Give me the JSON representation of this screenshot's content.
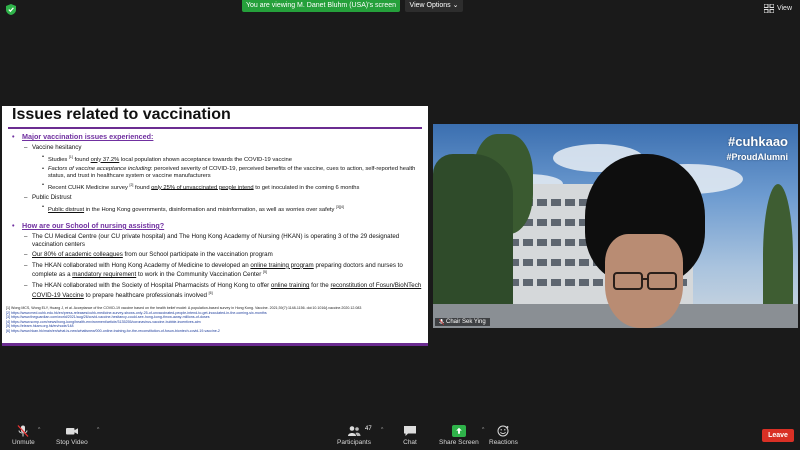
{
  "topbar": {
    "banner_text": "You are viewing M. Danet Bluhm (USA)'s screen",
    "view_options_label": "View Options ⌄",
    "view_label": "View",
    "banner_color": "#25a03b"
  },
  "slide": {
    "title": "Issues related to vaccination",
    "accent_color": "#7030a0",
    "section1": {
      "heading": "Major vaccination issues experienced:",
      "hesitancy_label": "Vaccine hesitancy",
      "b1_pre": "Studies ",
      "b1_ref": "[1]",
      "b1_mid": " found ",
      "b1_u": "only 37.2%",
      "b1_post": " local population shown acceptance towards the COVID-19 vaccine",
      "b2_italic": "Factors of vaccine acceptance including",
      "b2_rest": ": perceived severity of COVID-19, perceived benefits of the vaccine, cues to action, self-reported health status, and trust in healthcare system or vaccine manufacturers",
      "b3_pre": "Recent CUHK Medicine survey ",
      "b3_ref": "[2]",
      "b3_mid": " found ",
      "b3_u": "only 25% of unvaccinated people intend",
      "b3_post": " to get inoculated in the coming 6 months",
      "distrust_label": "Public Distrust",
      "b4_u": "Public distrust",
      "b4_post": " in the Hong Kong governments, disinformation and misinformation, as well as worries over safety ",
      "b4_ref": "[3][4]"
    },
    "section2": {
      "heading": "How are our School of nursing assisting?",
      "i1": "The CU Medical Centre (our CU private hospital) and The Hong Kong Academy of Nursing (HKAN) is operating 3 of the 29 designated vaccination centers",
      "i2_u": "Our 80% of academic colleagues",
      "i2_post": " from our School participate in the vaccination program",
      "i3_pre": "The HKAN collaborated with Hong Kong Academy of Medicine to developed an ",
      "i3_u1": "online training program",
      "i3_mid": " preparing doctors and nurses to complete as a ",
      "i3_u2": "mandatory requirement",
      "i3_post": " to work in the Community Vaccination Center ",
      "i3_ref": "[5]",
      "i4_pre": "The HKAN collaborated with the Society of Hospital Pharmacists of Hong Kong to offer ",
      "i4_u1": "online training",
      "i4_mid": " for the ",
      "i4_u2": "reconstitution of Fosun/BioNTech COVID-19 Vaccine",
      "i4_post": " to prepare healthcare professionals involved ",
      "i4_ref": "[6]"
    },
    "references": [
      "[1] Wong MCS, Wong ELY, Huang J, et al. Acceptance of the COVID-19 vaccine based on the health belief model: A population-based survey in Hong Kong. Vaccine. 2021;39(7):1148-1156. doi:10.1016/j.vaccine.2020.12.083",
      "[2] https://www.med.cuhk.edu.hk/en/press-releases/cuhk-medicine-survey-shows-only-25-of-unvaccinated-people-intend-to-get-inoculated-in-the-coming-six-months",
      "[3] https://www.theguardian.com/world/2021/aug/26/covid-vaccine-hesitancy-could-see-hong-kong-throw-away-millions-of-doses",
      "[4] https://www.scmp.com/news/hong-kong/health-environment/article/3135255/coronavirus-vaccine-bubble-incentives-aim",
      "[5] https://elearn.hkam.org.hk/en/node/148",
      "[6] https://www.hkan.hk/main/en/what-is-new/whatisnew/000-online-training-for-the-reconstitution-of-fosun-biontech-covid-19-vaccine-2"
    ]
  },
  "video": {
    "hashtag_main": "#cuhkaao",
    "hashtag_sub": "#ProudAlumni",
    "participant_name": "Chair Sek Ying"
  },
  "toolbar": {
    "unmute_label": "Unmute",
    "stop_video_label": "Stop Video",
    "participants_label": "Participants",
    "participants_count": "47",
    "chat_label": "Chat",
    "share_screen_label": "Share Screen",
    "reactions_label": "Reactions",
    "leave_label": "Leave",
    "leave_color": "#d93025",
    "share_color": "#2fb34a"
  }
}
